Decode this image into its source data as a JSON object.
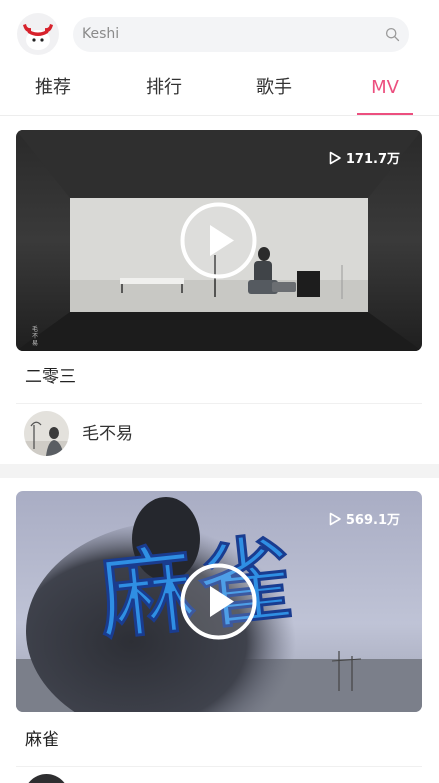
{
  "search": {
    "placeholder": "Keshi"
  },
  "tabs": [
    {
      "label": "推荐"
    },
    {
      "label": "排行"
    },
    {
      "label": "歌手"
    },
    {
      "label": "MV"
    }
  ],
  "mvs": [
    {
      "views": "171.7万",
      "title": "二零三",
      "author": "毛不易",
      "side_caption": "毛不易"
    },
    {
      "views": "569.1万",
      "title": "麻雀",
      "cover_text": "麻雀"
    }
  ],
  "colors": {
    "accent": "#ec4f7f"
  }
}
